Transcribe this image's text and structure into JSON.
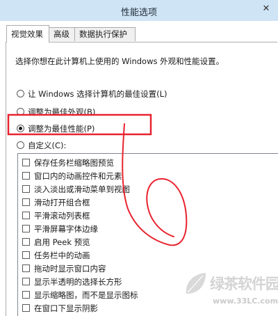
{
  "window": {
    "title": "性能选项",
    "close_glyph": "✕"
  },
  "tabs": [
    {
      "label": "视觉效果",
      "active": true
    },
    {
      "label": "高级",
      "active": false
    },
    {
      "label": "数据执行保护",
      "active": false
    }
  ],
  "description": "选择你想在此计算机上使用的 Windows 外观和性能设置。",
  "radio_options": [
    {
      "label": "让 Windows 选择计算机的最佳设置(L)",
      "selected": false
    },
    {
      "label": "调整为最佳外观(B)",
      "selected": false
    },
    {
      "label": "调整为最佳性能(P)",
      "selected": true
    },
    {
      "label": "自定义(C):",
      "selected": false
    }
  ],
  "effects": [
    {
      "label": "保存任务栏缩略图预览",
      "checked": false
    },
    {
      "label": "窗口内的动画控件和元素",
      "checked": false
    },
    {
      "label": "淡入淡出或滑动菜单到视图",
      "checked": false
    },
    {
      "label": "滑动打开组合框",
      "checked": false
    },
    {
      "label": "平滑滚动列表框",
      "checked": false
    },
    {
      "label": "平滑屏幕字体边缘",
      "checked": false
    },
    {
      "label": "启用 Peek 预览",
      "checked": false
    },
    {
      "label": "任务栏中的动画",
      "checked": false
    },
    {
      "label": "拖动时显示窗口内容",
      "checked": false
    },
    {
      "label": "显示半透明的选择长方形",
      "checked": false
    },
    {
      "label": "显示缩略图，而不是显示图标",
      "checked": false
    },
    {
      "label": "在窗口下显示阴影",
      "checked": false
    }
  ],
  "watermark": {
    "text": "绿茶软件园",
    "url": "www.33LC.com"
  },
  "colors": {
    "titlebar": "#cfe4f5",
    "annotation": "#e8232f"
  }
}
